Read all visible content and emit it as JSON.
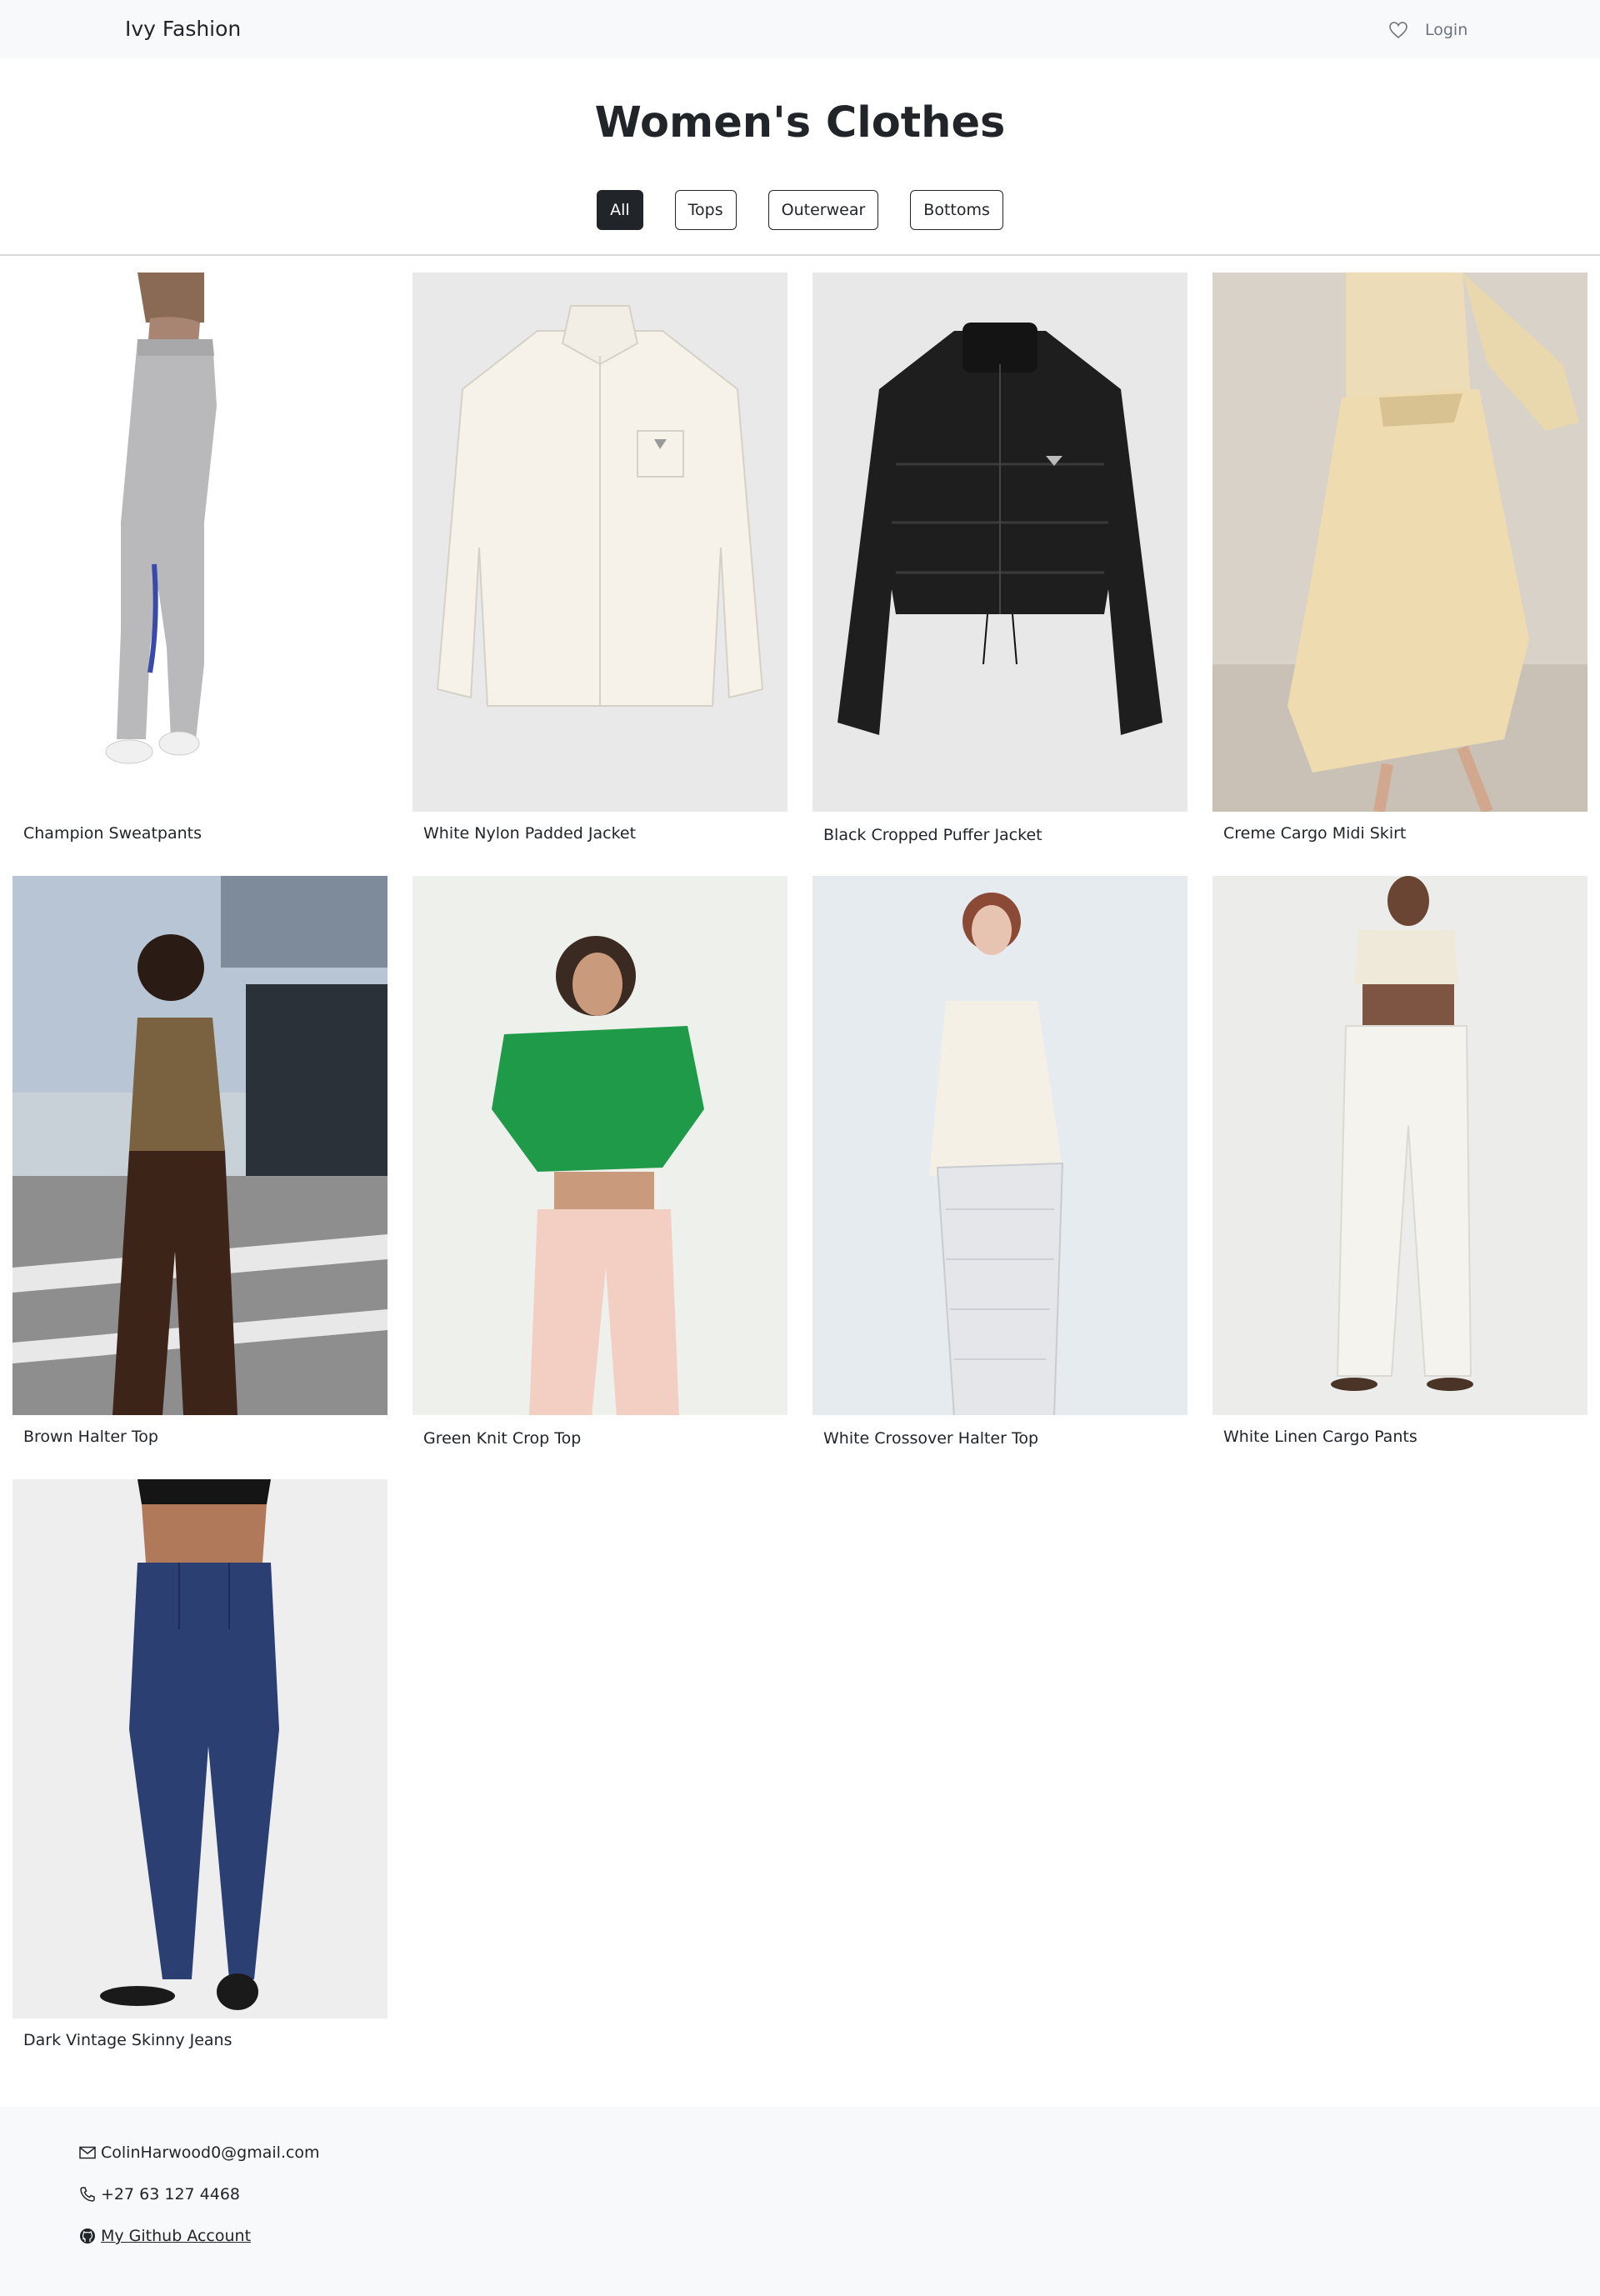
{
  "navbar": {
    "brand": "Ivy Fashion",
    "wishlist_icon": "heart-icon",
    "login_label": "Login"
  },
  "page": {
    "title": "Women's Clothes"
  },
  "filters": [
    {
      "label": "All",
      "active": true
    },
    {
      "label": "Tops",
      "active": false
    },
    {
      "label": "Outerwear",
      "active": false
    },
    {
      "label": "Bottoms",
      "active": false
    }
  ],
  "products": [
    {
      "name": "Champion Sweatpants"
    },
    {
      "name": "White Nylon Padded Jacket"
    },
    {
      "name": "Black Cropped Puffer Jacket"
    },
    {
      "name": "Creme Cargo Midi Skirt"
    },
    {
      "name": "Brown Halter Top"
    },
    {
      "name": "Green Knit Crop Top"
    },
    {
      "name": "White Crossover Halter Top"
    },
    {
      "name": "White Linen Cargo Pants"
    },
    {
      "name": "Dark Vintage Skinny Jeans"
    }
  ],
  "footer": {
    "email": "ColinHarwood0@gmail.com",
    "phone": "+27 63 127 4468",
    "github_label": "My Github Account",
    "email_icon": "envelope-icon",
    "phone_icon": "phone-icon",
    "github_icon": "github-icon"
  }
}
